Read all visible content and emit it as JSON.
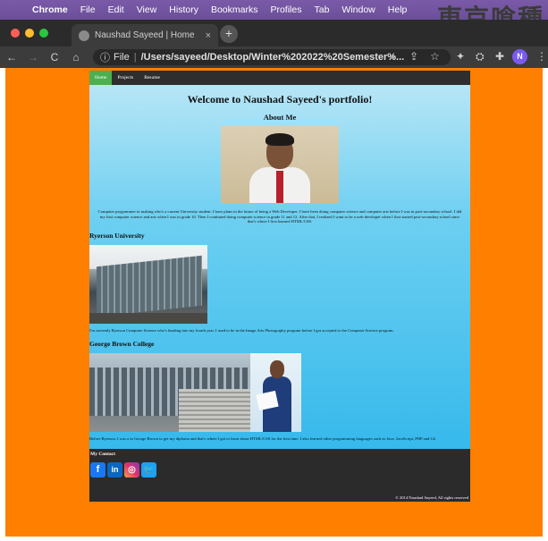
{
  "menubar": {
    "app": "Chrome",
    "items": [
      "File",
      "Edit",
      "View",
      "History",
      "Bookmarks",
      "Profiles",
      "Tab",
      "Window",
      "Help"
    ],
    "decorative_text": "東京喰種"
  },
  "browser": {
    "tab_title": "Naushad Sayeed | Home",
    "tab_close": "×",
    "new_tab": "+",
    "nav": {
      "back": "←",
      "forward": "→",
      "reload": "C",
      "home": "⌂"
    },
    "omnibox": {
      "info": "ⓘ",
      "scheme": "File",
      "url": "/Users/sayeed/Desktop/Winter%202022%20Semester%..."
    },
    "toolbar_icons": {
      "zoom": "⌕",
      "share": "⇪",
      "bookmark": "☆",
      "extension1": "✦",
      "extension2": "⛭",
      "puzzle": "✚",
      "menu": "⋮"
    },
    "profile_initial": "N"
  },
  "site": {
    "nav": [
      "Home",
      "Projects",
      "Resume"
    ],
    "title": "Welcome to Naushad Sayeed's portfolio!",
    "about_heading": "About Me",
    "about_text": "Computer programmer in making who's a current University student. I have plans in the future of being a Web Developer. I have been doing computer science and computer arts before I was in post-secondary school. I did my first computer science and arts when I was in grade 10. Then I continued doing computer science in grade 11 and 12. After that, I realized I want to be a web developer when I first started post-secondary school since that's where I first learned HTML/CSS.",
    "ryerson_heading": "Ryerson University",
    "ryerson_text": "I'm currently Ryerson Computer Science who's heading into my fourth year. I used to be in the Image Arts Photography program before I got accepted to the Computer Science program.",
    "gbc_heading": "George Brown College",
    "gbc_text": "Before Ryerson, I was a in George Brown to get my diploma and that's where I got to learn about HTML/CSS for the first time. I also learned other programming languages such as Java, JavaScript, PHP and C#.",
    "contact_heading": "My Contact",
    "socials": {
      "facebook": "f",
      "linkedin": "in",
      "instagram": "◎",
      "twitter": "🐦"
    },
    "copyright": "© 2014 Naushad Sayeed, All rights reserved"
  },
  "colors": {
    "page_background": "#ff7f00",
    "nav_active": "#4caf50",
    "footer": "#2b2b2b"
  }
}
